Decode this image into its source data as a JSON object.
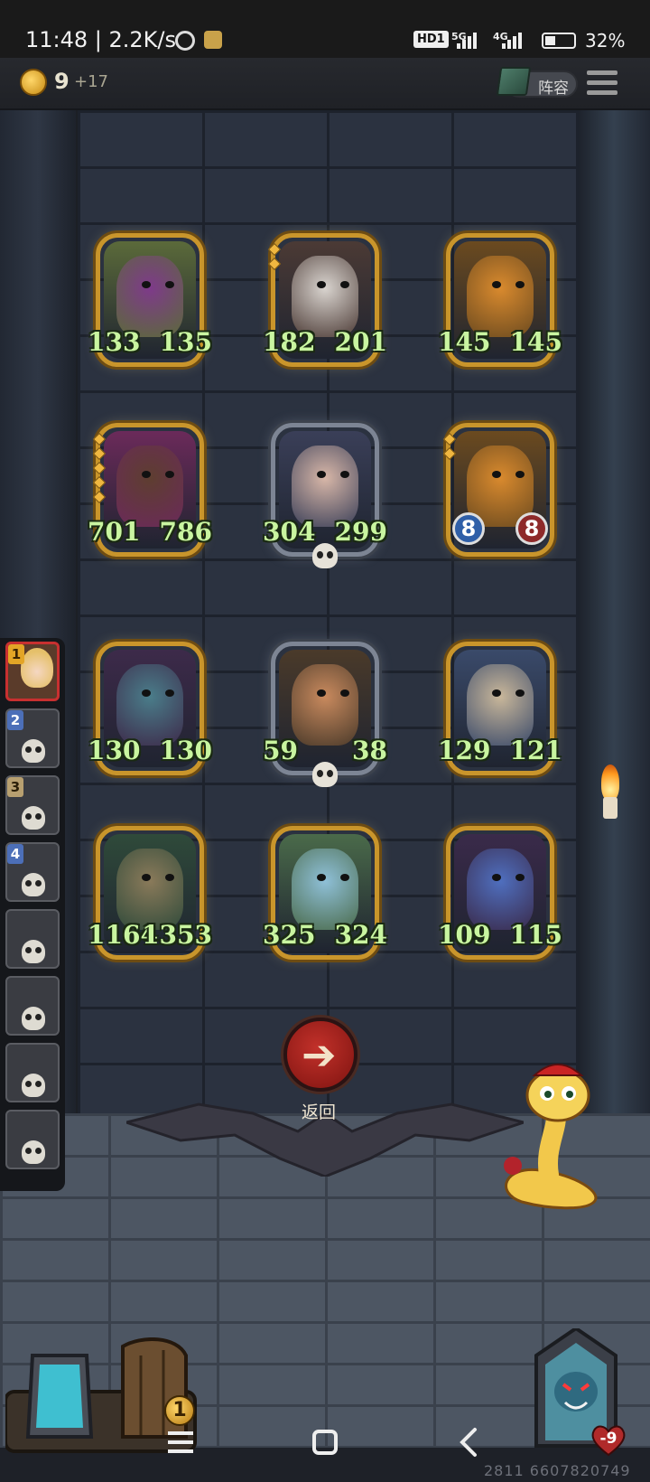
{
  "status_bar": {
    "time": "11:48",
    "speed": "2.2K/s",
    "hd": "HD1",
    "net1": "5G",
    "net2": "4G",
    "battery": "32%"
  },
  "top_bar": {
    "coins": "9",
    "coin_income": "+17",
    "lineup_label": "阵容"
  },
  "board": {
    "rows": [
      [
        {
          "attack": "133",
          "health": "135",
          "frame": "gold"
        },
        {
          "attack": "182",
          "health": "201",
          "frame": "gold"
        },
        {
          "attack": "145",
          "health": "145",
          "frame": "gold"
        }
      ],
      [
        {
          "attack": "701",
          "health": "786",
          "frame": "gold"
        },
        {
          "attack": "304",
          "health": "299",
          "frame": "silver"
        },
        {
          "attack": "8",
          "health": "8",
          "frame": "gold"
        }
      ],
      [
        {
          "attack": "130",
          "health": "130",
          "frame": "gold"
        },
        {
          "attack": "59",
          "health": "38",
          "frame": "silver"
        },
        {
          "attack": "129",
          "health": "121",
          "frame": "gold"
        }
      ],
      [
        {
          "attack": "1164",
          "health": "1353",
          "frame": "gold"
        },
        {
          "attack": "325",
          "health": "324",
          "frame": "gold"
        },
        {
          "attack": "109",
          "health": "115",
          "frame": "gold"
        }
      ]
    ]
  },
  "sidebar": {
    "slots": [
      {
        "rank": "1"
      },
      {
        "rank": "2"
      },
      {
        "rank": "3"
      },
      {
        "rank": "4"
      },
      {
        "rank": ""
      },
      {
        "rank": ""
      },
      {
        "rank": ""
      },
      {
        "rank": ""
      }
    ]
  },
  "back_button": {
    "label": "返回"
  },
  "bottom_hud": {
    "tavern_tier": "1",
    "hero_health": "-9"
  },
  "watermark": "2811 6607820749"
}
